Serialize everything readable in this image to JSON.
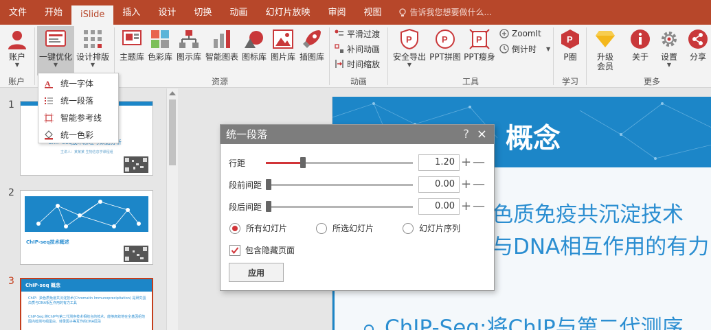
{
  "tabs": [
    "文件",
    "开始",
    "iSlide",
    "插入",
    "设计",
    "切换",
    "动画",
    "幻灯片放映",
    "审阅",
    "视图"
  ],
  "active_tab": "iSlide",
  "tell_me": "告诉我您想要做什么...",
  "ribbon": {
    "account": {
      "label": "账户",
      "group": "账户"
    },
    "optimize": {
      "label": "一键优化"
    },
    "layout": {
      "label": "设计排版"
    },
    "resources": {
      "group": "资源",
      "items": [
        "主题库",
        "色彩库",
        "图示库",
        "智能图表",
        "图标库",
        "图片库",
        "插图库"
      ]
    },
    "animation": {
      "group": "动画",
      "items": [
        "平滑过渡",
        "补间动画",
        "时间缩放"
      ]
    },
    "tools": {
      "group": "工具",
      "items": [
        "安全导出",
        "PPT拼图",
        "PPT瘦身"
      ],
      "zoomit": "ZoomIt",
      "timer": "倒计时"
    },
    "learn": {
      "group": "学习",
      "item": "P圈"
    },
    "more": {
      "group": "更多",
      "upgrade_line1": "升级",
      "upgrade_line2": "会员",
      "about": "关于",
      "settings": "设置",
      "share": "分享"
    }
  },
  "dropdown": [
    "统一字体",
    "统一段落",
    "智能参考线",
    "统一色彩"
  ],
  "slides": {
    "numbers": [
      "1",
      "2",
      "3"
    ],
    "thumb1": {
      "title": "ChIP-seq技术原理与数据分析",
      "sub": "主讲人：某某某  生物信息学课程组"
    },
    "thumb2": {
      "title": "ChIP-seq技术概述"
    },
    "thumb3": {
      "title": "ChIP-seq 概念",
      "lines": [
        "ChIP：染色质免疫共沉淀技术(Chromatin Immunoprecipitation) 是研究蛋白质与DNA相互作用的有力工具",
        "ChIP-Seq:将ChIP与第二代测序技术相结合的技术，能够高效地在全基因组范围内检测与组蛋白、转录因子等互作的DNA区段"
      ]
    }
  },
  "main_slide": {
    "title": "概念",
    "line1": "色质免疫共沉淀技术",
    "line2": "与DNA相互作用的有力",
    "line3": "ChIP-Seq:将ChIP与第二代测序"
  },
  "dialog": {
    "title": "统一段落",
    "help": "?",
    "close": "×",
    "rows": [
      {
        "label": "行距",
        "value": "1.20",
        "level": 0.25
      },
      {
        "label": "段前间距",
        "value": "0.00",
        "level": 0
      },
      {
        "label": "段后间距",
        "value": "0.00",
        "level": 0
      }
    ],
    "plus": "+",
    "minus": "—",
    "radios": [
      {
        "label": "所有幻灯片",
        "checked": true
      },
      {
        "label": "所选幻灯片",
        "checked": false
      },
      {
        "label": "幻灯片序列",
        "checked": false
      }
    ],
    "include_hidden": "包含隐藏页面",
    "include_hidden_checked": true,
    "apply": "应用"
  },
  "colors": {
    "brand": "#b7472a",
    "accent_red": "#d13438",
    "slide_blue": "#1c86c8"
  }
}
